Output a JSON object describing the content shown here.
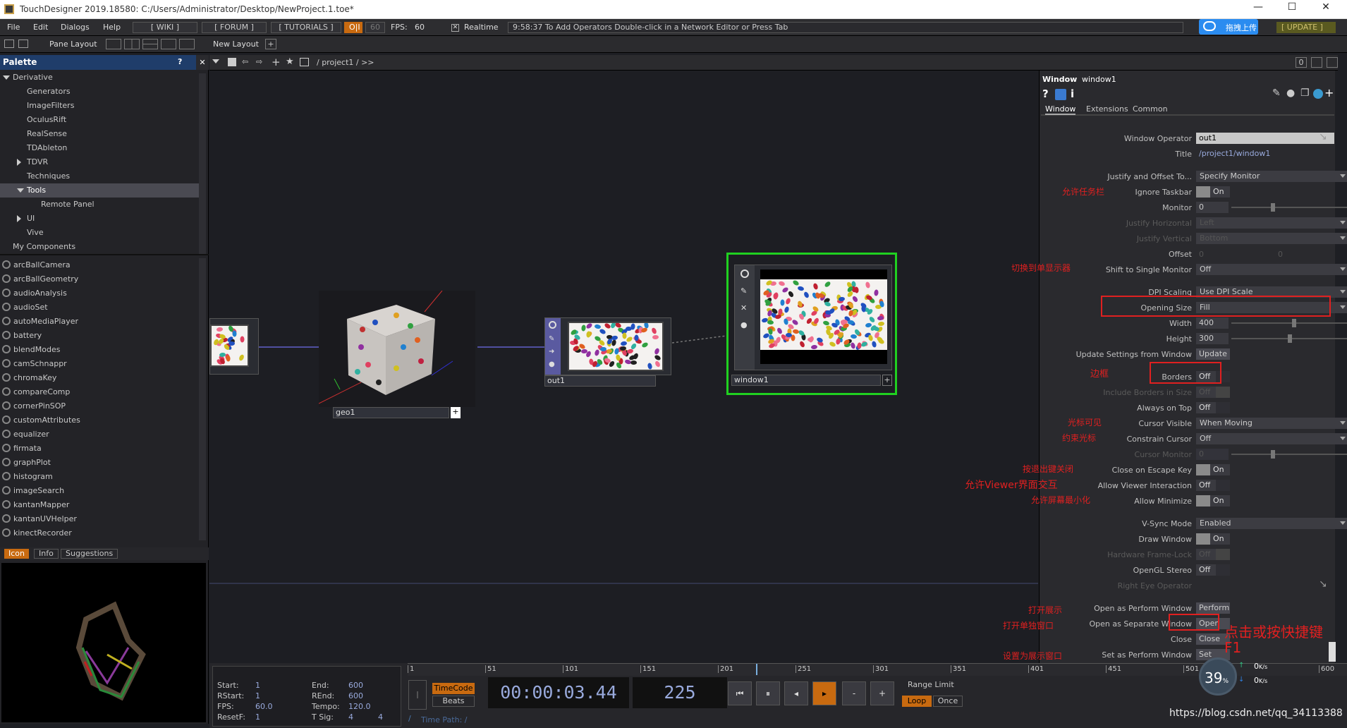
{
  "titlebar": {
    "title": "TouchDesigner 2019.18580: C:/Users/Administrator/Desktop/NewProject.1.toe*",
    "minimize": "—",
    "maximize": "☐",
    "close": "✕"
  },
  "menubar": {
    "items": [
      "File",
      "Edit",
      "Dialogs",
      "Help"
    ],
    "wiki": "[ WIKI ]",
    "forum": "[ FORUM ]",
    "tutorials": "[ TUTORIALS ]",
    "oi": "O|I",
    "fps_cap": "60",
    "fps_label": "FPS:",
    "fps": "60",
    "realtime": "Realtime",
    "status": "9:58:37 To Add Operators Double-click in a Network Editor or Press Tab",
    "upload": "拖拽上传",
    "update": "[ UPDATE ]"
  },
  "row2": {
    "pane_layout": "Pane Layout",
    "new_layout": "New Layout",
    "path": "/ project1 / >>",
    "zero": "0"
  },
  "palette": {
    "title": "Palette",
    "help": "?",
    "close": "✕",
    "tree": [
      {
        "label": "Derivative",
        "indent": 0,
        "arrow": "down"
      },
      {
        "label": "Generators",
        "indent": 1
      },
      {
        "label": "ImageFilters",
        "indent": 1
      },
      {
        "label": "OculusRift",
        "indent": 1
      },
      {
        "label": "RealSense",
        "indent": 1
      },
      {
        "label": "TDAbleton",
        "indent": 1
      },
      {
        "label": "TDVR",
        "indent": 1,
        "arrow": "right"
      },
      {
        "label": "Techniques",
        "indent": 1
      },
      {
        "label": "Tools",
        "indent": 1,
        "arrow": "down",
        "selected": true
      },
      {
        "label": "Remote Panel",
        "indent": 2
      },
      {
        "label": "UI",
        "indent": 1,
        "arrow": "right"
      },
      {
        "label": "Vive",
        "indent": 1
      },
      {
        "label": "My Components",
        "indent": 0
      }
    ],
    "components": [
      "arcBallCamera",
      "arcBallGeometry",
      "audioAnalysis",
      "audioSet",
      "autoMediaPlayer",
      "battery",
      "blendModes",
      "camSchnappr",
      "chromaKey",
      "compareComp",
      "cornerPinSOP",
      "customAttributes",
      "equalizer",
      "firmata",
      "graphPlot",
      "histogram",
      "imageSearch",
      "kantanMapper",
      "kantanUVHelper",
      "kinectRecorder"
    ],
    "tabs": [
      "Icon",
      "Info",
      "Suggestions"
    ]
  },
  "network": {
    "nodes": {
      "geo": "geo1",
      "out": "out1",
      "window": "window1"
    }
  },
  "params": {
    "header_type": "Window",
    "header_name": "window1",
    "tabs": [
      "Window",
      "Extensions",
      "Common"
    ],
    "window_operator_label": "Window Operator",
    "window_operator": "out1",
    "title_label": "Title",
    "title": "/project1/window1",
    "rows": {
      "justify": {
        "label": "Justify and Offset To...",
        "value": "Specify Monitor"
      },
      "ignore_taskbar": {
        "label": "Ignore Taskbar",
        "value": "On"
      },
      "monitor": {
        "label": "Monitor",
        "value": "0"
      },
      "justify_h": {
        "label": "Justify Horizontal",
        "value": "Left"
      },
      "justify_v": {
        "label": "Justify Vertical",
        "value": "Bottom"
      },
      "offset": {
        "label": "Offset",
        "value1": "0",
        "value2": "0"
      },
      "shift_single": {
        "label": "Shift to Single Monitor",
        "value": "Off"
      },
      "dpi": {
        "label": "DPI Scaling",
        "value": "Use DPI Scale"
      },
      "opening_size": {
        "label": "Opening Size",
        "value": "Fill"
      },
      "width": {
        "label": "Width",
        "value": "400"
      },
      "height": {
        "label": "Height",
        "value": "300"
      },
      "update_settings": {
        "label": "Update Settings from Window",
        "value": "Update"
      },
      "borders": {
        "label": "Borders",
        "value": "Off"
      },
      "include_borders": {
        "label": "Include Borders in Size",
        "value": "Off"
      },
      "always_top": {
        "label": "Always on Top",
        "value": "Off"
      },
      "cursor_visible": {
        "label": "Cursor Visible",
        "value": "When Moving"
      },
      "constrain_cursor": {
        "label": "Constrain Cursor",
        "value": "Off"
      },
      "cursor_monitor": {
        "label": "Cursor Monitor",
        "value": "0"
      },
      "close_escape": {
        "label": "Close on Escape Key",
        "value": "On"
      },
      "viewer_interaction": {
        "label": "Allow Viewer Interaction",
        "value": "Off"
      },
      "allow_minimize": {
        "label": "Allow Minimize",
        "value": "On"
      },
      "vsync": {
        "label": "V-Sync Mode",
        "value": "Enabled"
      },
      "draw_window": {
        "label": "Draw Window",
        "value": "On"
      },
      "hw_framelock": {
        "label": "Hardware Frame-Lock",
        "value": "Off"
      },
      "opengl_stereo": {
        "label": "OpenGL Stereo",
        "value": "Off"
      },
      "right_eye": {
        "label": "Right Eye Operator"
      },
      "open_perform": {
        "label": "Open as Perform Window",
        "value": "Perform"
      },
      "open_separate": {
        "label": "Open as Separate Window",
        "value": "Open"
      },
      "close": {
        "label": "Close",
        "value": "Close"
      },
      "set_perform": {
        "label": "Set as Perform Window",
        "value": "Set"
      }
    }
  },
  "annotations": {
    "ignore_taskbar": "允许任务栏",
    "shift_single": "切换到单显示器",
    "borders": "边框",
    "cursor_visible": "光标可见",
    "constrain_cursor": "约束光标",
    "close_escape": "按退出键关闭",
    "viewer_interaction": "允许Viewer界面交互",
    "allow_minimize": "允许屏幕最小化",
    "open_perform": "打开展示",
    "open_separate": "打开单独窗口",
    "set_perform": "设置为展示窗口",
    "shortcut": "点击或按快捷键",
    "shortcut_key": "F1"
  },
  "timeline": {
    "ticks": [
      "1",
      "51",
      "101",
      "151",
      "201",
      "251",
      "301",
      "351",
      "401",
      "451",
      "501",
      "600"
    ]
  },
  "transport": {
    "start_label": "Start:",
    "start": "1",
    "end_label": "End:",
    "end": "600",
    "rstart_label": "RStart:",
    "rstart": "1",
    "rend_label": "REnd:",
    "rend": "600",
    "fps_label": "FPS:",
    "fps": "60.0",
    "tempo_label": "Tempo:",
    "tempo": "120.0",
    "resetf_label": "ResetF:",
    "resetf": "1",
    "tsig_label": "T Sig:",
    "tsig1": "4",
    "tsig2": "4",
    "timecode_btn": "TimeCode",
    "beats_btn": "Beats",
    "timecode": "00:00:03.44",
    "frame": "225",
    "range_limit": "Range Limit",
    "loop": "Loop",
    "once": "Once",
    "time_path": "Time Path: /"
  },
  "overlay": {
    "percent": "39",
    "percent_unit": "%",
    "up": "0",
    "down": "0",
    "unit": "K/s"
  },
  "watermark": "https://blog.csdn.net/qq_34113388"
}
